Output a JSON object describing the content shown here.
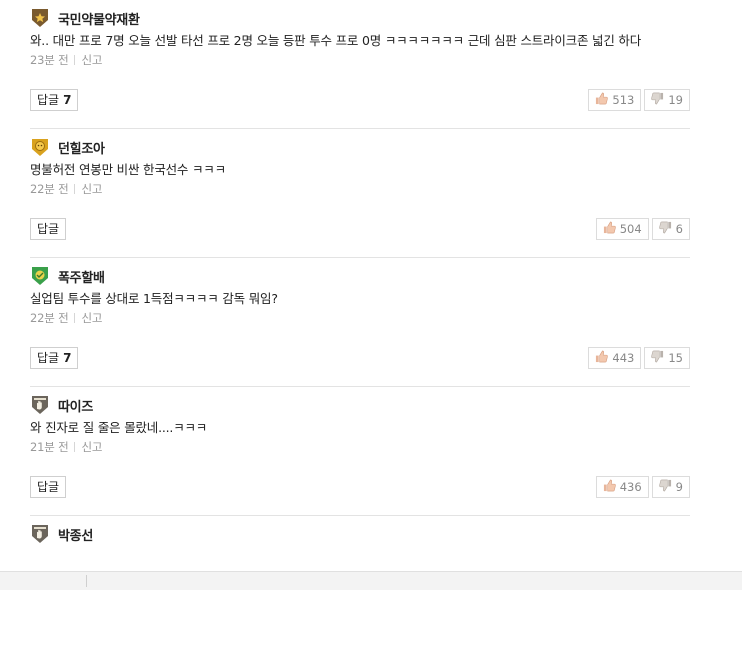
{
  "labels": {
    "reply": "답글",
    "report": "신고"
  },
  "comments": [
    {
      "nick": "국민약물약재환",
      "badge": "star-badge-icon",
      "text": "와.. 대만 프로 7명 오늘 선발 타선 프로 2명 오늘 등판 투수 프로 0명 ㅋㅋㅋㅋㅋㅋㅋ 근데 심판 스트라이크존 넓긴 하다",
      "time": "23분 전",
      "replies": "7",
      "likes": "513",
      "dislikes": "19"
    },
    {
      "nick": "던힐조아",
      "badge": "lion-badge-icon",
      "text": "명불허전 연봉만 비싼 한국선수 ㅋㅋㅋ",
      "time": "22분 전",
      "replies": "",
      "likes": "504",
      "dislikes": "6"
    },
    {
      "nick": "폭주할배",
      "badge": "green-badge-icon",
      "text": "실업팀 투수를 상대로 1득점ㅋㅋㅋㅋ 감독 뭐임?",
      "time": "22분 전",
      "replies": "7",
      "likes": "443",
      "dislikes": "15"
    },
    {
      "nick": "따이즈",
      "badge": "hand-badge-icon",
      "text": "와 진자로 질 줄은 몰랐네....ㅋㅋㅋ",
      "time": "21분 전",
      "replies": "",
      "likes": "436",
      "dislikes": "9"
    }
  ],
  "partial_comment": {
    "nick": "박종선",
    "badge": "hand-badge-icon"
  }
}
